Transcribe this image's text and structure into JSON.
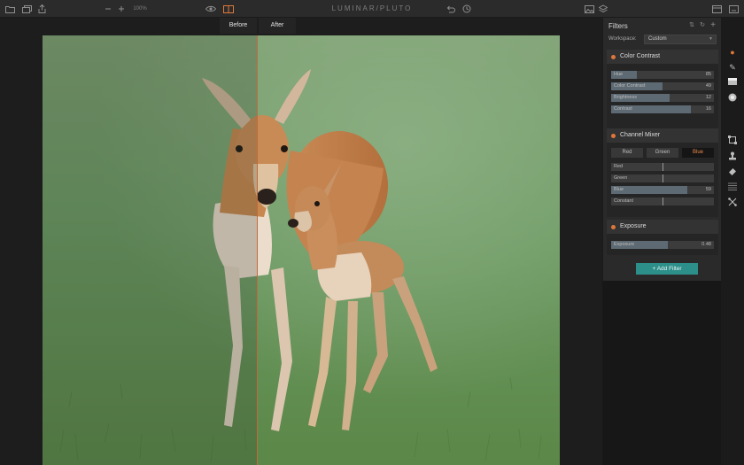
{
  "app": {
    "title": "LUMINAR/PLUTO"
  },
  "toolbar": {
    "zoom_label": "100%",
    "left_icons": [
      "folder-icon",
      "copy-icon",
      "share-icon",
      "zoom-out-icon",
      "zoom-in-icon"
    ],
    "center_icons": [
      "eye-icon",
      "compare-icon"
    ],
    "history_icons": [
      "undo-icon",
      "history-icon"
    ],
    "right_icons": [
      "image-icon",
      "layers-icon",
      "window-icon",
      "export-icon"
    ]
  },
  "compare": {
    "before_label": "Before",
    "after_label": "After",
    "split_color": "#c36a3b"
  },
  "panel": {
    "title": "Filters",
    "header_icons": [
      "sort-icon",
      "refresh-icon",
      "add-icon"
    ],
    "workspace_label": "Workspace:",
    "workspace_value": "Custom",
    "accent": "#e0773a",
    "sections": {
      "color_contrast": {
        "title": "Color Contrast",
        "sliders": [
          {
            "label": "Hue",
            "value": "85",
            "fill": 0.25
          },
          {
            "label": "Color Contrast",
            "value": "49",
            "fill": 0.5
          },
          {
            "label": "Brightness",
            "value": "12",
            "fill": 0.57
          },
          {
            "label": "Contrast",
            "value": "16",
            "fill": 0.78
          }
        ]
      },
      "channel_mixer": {
        "title": "Channel Mixer",
        "tabs": [
          "Red",
          "Green",
          "Blue"
        ],
        "active_tab": "Blue",
        "sliders": [
          {
            "label": "Red",
            "value": "",
            "fill": 0.5
          },
          {
            "label": "Green",
            "value": "",
            "fill": 0.5
          },
          {
            "label": "Blue",
            "value": "59",
            "fill": 0.74
          },
          {
            "label": "Constant",
            "value": "",
            "fill": 0.5
          }
        ]
      },
      "exposure": {
        "title": "Exposure",
        "sliders": [
          {
            "label": "Exposure",
            "value": "0.48",
            "fill": 0.55
          }
        ]
      }
    },
    "add_filter_label": "Add Filter",
    "add_filter_color": "#2d8f8a"
  },
  "tools": [
    "palette-icon",
    "brush-icon",
    "gradient-icon",
    "radial-icon",
    "crop-icon",
    "stamp-icon",
    "eraser-icon",
    "texture-icon",
    "transform-icon"
  ]
}
